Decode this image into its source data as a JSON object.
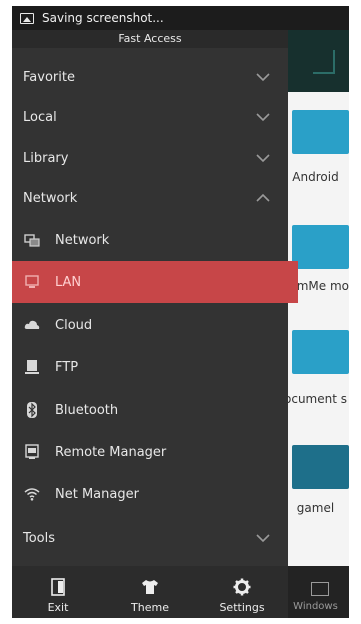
{
  "status_bar": {
    "notification": "Saving screenshot..."
  },
  "drawer": {
    "header": "Fast Access",
    "sections": {
      "favorite": "Favorite",
      "local": "Local",
      "library": "Library",
      "network": "Network",
      "tools": "Tools"
    },
    "network_items": [
      {
        "label": "Network",
        "icon": "network-icon"
      },
      {
        "label": "LAN",
        "icon": "monitor-icon",
        "selected": true
      },
      {
        "label": "Cloud",
        "icon": "cloud-icon"
      },
      {
        "label": "FTP",
        "icon": "server-icon"
      },
      {
        "label": "Bluetooth",
        "icon": "bluetooth-icon"
      },
      {
        "label": "Remote Manager",
        "icon": "remote-icon"
      },
      {
        "label": "Net Manager",
        "icon": "wifi-icon"
      }
    ],
    "bottom_bar": {
      "exit": "Exit",
      "theme": "Theme",
      "settings": "Settings"
    }
  },
  "background": {
    "folders": [
      "Android",
      "eamMe mo",
      "ocument s",
      "gamel"
    ],
    "windows_label": "Windows"
  },
  "colors": {
    "drawer_bg": "#333333",
    "selected_bg": "#c74648",
    "folder_blue": "#2aa0c8"
  }
}
